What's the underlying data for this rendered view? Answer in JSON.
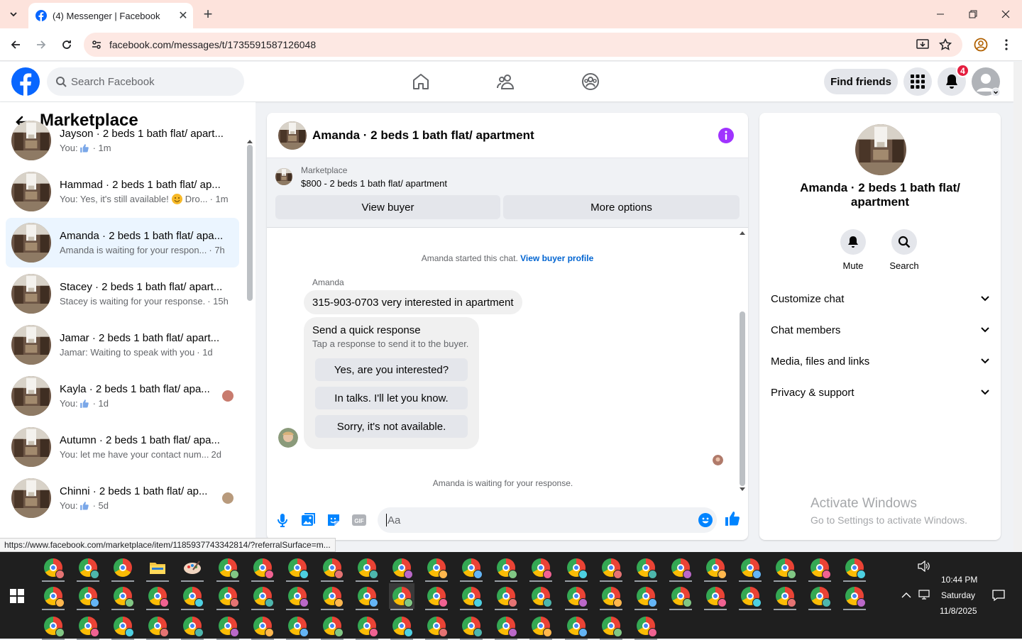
{
  "browser": {
    "tab_title": "(4) Messenger | Facebook",
    "tab_close": "✕",
    "new_tab": "+",
    "url": "facebook.com/messages/t/1735591587126048",
    "status_url": "https://www.facebook.com/marketplace/item/1185937743342814/?referralSurface=m..."
  },
  "fb": {
    "search_placeholder": "Search Facebook",
    "find_friends": "Find friends",
    "notif_count": "4"
  },
  "left": {
    "title": "Marketplace",
    "threads": [
      {
        "name": "Jayson · 2 beds 1 bath flat/ apart...",
        "pre": "You:",
        "preview": "",
        "like": true,
        "time": "· 1m",
        "active": false
      },
      {
        "name": "Hammad · 2 beds 1 bath flat/ ap...",
        "pre": "You: Yes, it's still available!",
        "preview": "Dro...",
        "emoji": true,
        "time": "· 1m",
        "active": false
      },
      {
        "name": "Amanda · 2 beds 1 bath flat/ apa...",
        "pre": "Amanda is waiting for your respon...",
        "preview": "",
        "time": "· 7h",
        "active": true
      },
      {
        "name": "Stacey · 2 beds 1 bath flat/ apart...",
        "pre": "Stacey is waiting for your response.",
        "preview": "",
        "time": "· 15h",
        "active": false
      },
      {
        "name": "Jamar · 2 beds 1 bath flat/ apart...",
        "pre": "Jamar: Waiting to speak with you",
        "preview": "",
        "time": "· 1d",
        "active": false
      },
      {
        "name": "Kayla · 2 beds 1 bath flat/ apa...",
        "pre": "You:",
        "preview": "",
        "like": true,
        "time": "· 1d",
        "active": false,
        "avatar": "#c87b6e"
      },
      {
        "name": "Autumn · 2 beds 1 bath flat/ apa...",
        "pre": "You: let me have your contact num...",
        "preview": "",
        "time": "2d",
        "active": false
      },
      {
        "name": "Chinni · 2 beds 1 bath flat/ ap...",
        "pre": "You:",
        "preview": "",
        "like": true,
        "time": "· 5d",
        "active": false,
        "avatar": "#b89a7c"
      }
    ]
  },
  "chat": {
    "title": "Amanda · 2 beds 1 bath flat/ apartment",
    "marketplace_label": "Marketplace",
    "listing": "$800 - 2 beds 1 bath flat/ apartment",
    "view_buyer": "View buyer",
    "more_options": "More options",
    "started_text": "Amanda started this chat.",
    "view_profile": "View buyer profile",
    "sender": "Amanda",
    "message": "315-903-0703 very interested in apartment",
    "quick_title": "Send a quick response",
    "quick_sub": "Tap a response to send it to the buyer.",
    "quick_options": [
      "Yes, are you interested?",
      "In talks. I'll let you know.",
      "Sorry, it's not available."
    ],
    "waiting": "Amanda is waiting for your response.",
    "input_placeholder": "Aa"
  },
  "right": {
    "name": "Amanda · 2 beds 1 bath flat/ apartment",
    "mute": "Mute",
    "search": "Search",
    "sections": [
      "Customize chat",
      "Chat members",
      "Media, files and links",
      "Privacy & support"
    ],
    "watermark_1": "Activate Windows",
    "watermark_2": "Go to Settings to activate Windows."
  },
  "taskbar": {
    "time": "10:44 PM",
    "day": "Saturday",
    "date": "11/8/2025"
  },
  "colors": {
    "fb_blue": "#0866ff",
    "messenger_blue": "#0084ff",
    "info_purple": "#a033ff",
    "badge_red": "#e41e3f"
  }
}
